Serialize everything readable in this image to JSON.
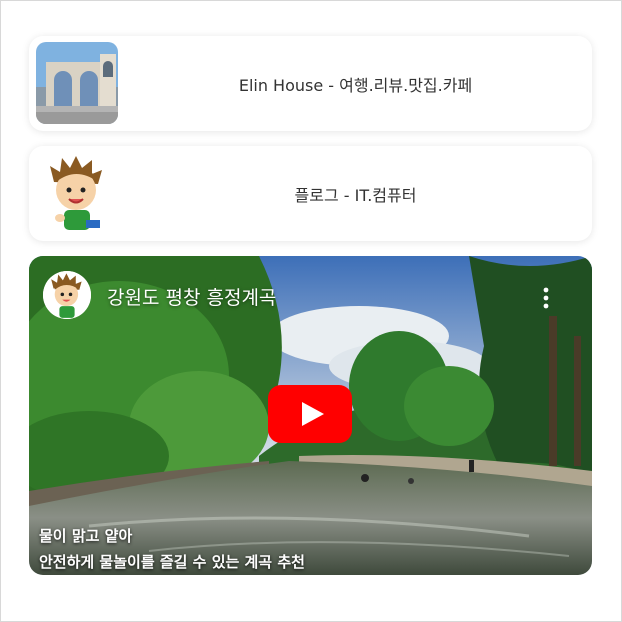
{
  "cards": [
    {
      "label": "Elin House - 여행.리뷰.맛집.카페",
      "icon": "bell-tower-photo"
    },
    {
      "label": "플로그 - IT.컴퓨터",
      "icon": "cartoon-boy-avatar"
    }
  ],
  "video": {
    "title": "강원도 평창 흥정계곡",
    "caption_line1": "물이 맑고 얕아",
    "caption_line2": "안전하게 물놀이를 즐길 수 있는 계곡 추천",
    "play_color": "#ff0000"
  }
}
